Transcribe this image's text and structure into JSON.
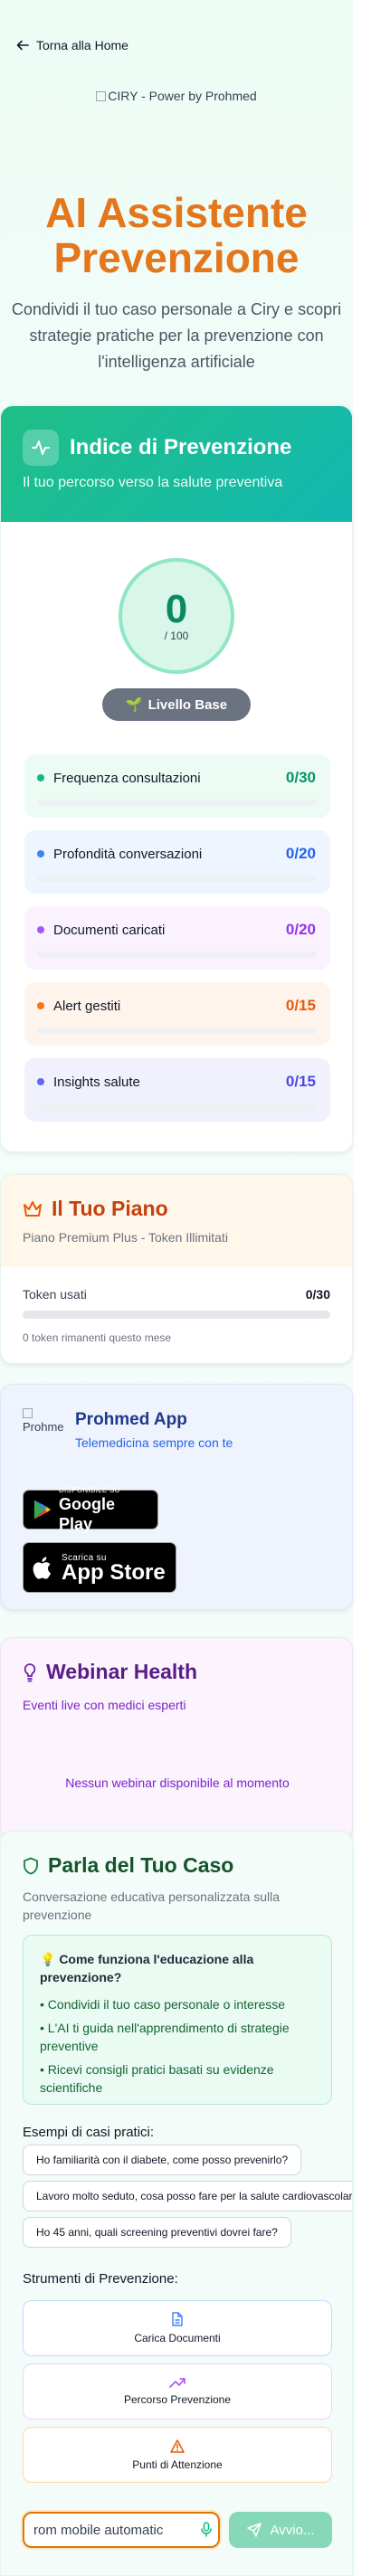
{
  "nav": {
    "back_label": "Torna alla Home"
  },
  "logo": {
    "alt": "CIRY - Power by Prohmed"
  },
  "hero": {
    "title": "AI Assistente Prevenzione",
    "subtitle": "Condividi il tuo caso personale a Ciry e scopri strategie pratiche per la prevenzione con l'intelligenza artificiale"
  },
  "index_card": {
    "title": "Indice di Prevenzione",
    "subtitle": "Il tuo percorso verso la salute preventiva",
    "score": "0",
    "score_max": "/ 100",
    "level": "Livello Base",
    "metrics": [
      {
        "label": "Frequenza consultazioni",
        "value": "0/30",
        "color": "#10b981",
        "bg": "#ecfbf4",
        "val_color": "#059669"
      },
      {
        "label": "Profondità conversazioni",
        "value": "0/20",
        "color": "#3b82f6",
        "bg": "#eef5fe",
        "val_color": "#2563eb"
      },
      {
        "label": "Documenti caricati",
        "value": "0/20",
        "color": "#a855f7",
        "bg": "#faf2fe",
        "val_color": "#9333ea"
      },
      {
        "label": "Alert gestiti",
        "value": "0/15",
        "color": "#f97316",
        "bg": "#fef4ec",
        "val_color": "#ea580c"
      },
      {
        "label": "Insights salute",
        "value": "0/15",
        "color": "#6366f1",
        "bg": "#f0f1fd",
        "val_color": "#4f46e5"
      }
    ],
    "progress": 0
  },
  "plan": {
    "title": "Il Tuo Piano",
    "subtitle": "Piano Premium Plus - Token Illimitati",
    "tokens_label": "Token usati",
    "tokens_value": "0/30",
    "note": "0 token rimanenti questo mese",
    "token_fraction": 0
  },
  "app": {
    "logo_alt": "Prohmed",
    "name": "Prohmed App",
    "tagline": "Telemedicina sempre con te",
    "google_small": "DISPONIBILE SU",
    "google_big": "Google Play",
    "apple_small": "Scarica su",
    "apple_big": "App Store"
  },
  "webinar": {
    "title": "Webinar Health",
    "subtitle": "Eventi live con medici esperti",
    "empty": "Nessun webinar disponibile al momento"
  },
  "chat": {
    "title": "Parla del Tuo Caso",
    "subtitle": "Conversazione educativa personalizzata sulla prevenzione",
    "info_title": "💡 Come funziona l'educazione alla prevenzione?",
    "info_items": [
      "• Condividi il tuo caso personale o interesse",
      "• L'AI ti guida nell'apprendimento di strategie preventive",
      "• Ricevi consigli pratici basati su evidenze scientifiche"
    ],
    "examples_label": "Esempi di casi pratici:",
    "examples": [
      "Ho familiarità con il diabete, come posso prevenirlo?",
      "Lavoro molto seduto, cosa posso fare per la salute cardiovascolare?",
      "Ho 45 anni, quali screening preventivi dovrei fare?"
    ],
    "tools_label": "Strumenti di Prevenzione:",
    "tools": [
      "Carica Documenti",
      "Percorso Prevenzione",
      "Punti di Attenzione"
    ],
    "input_value": "rom mobile automatic",
    "send_label": "Avvio..."
  }
}
